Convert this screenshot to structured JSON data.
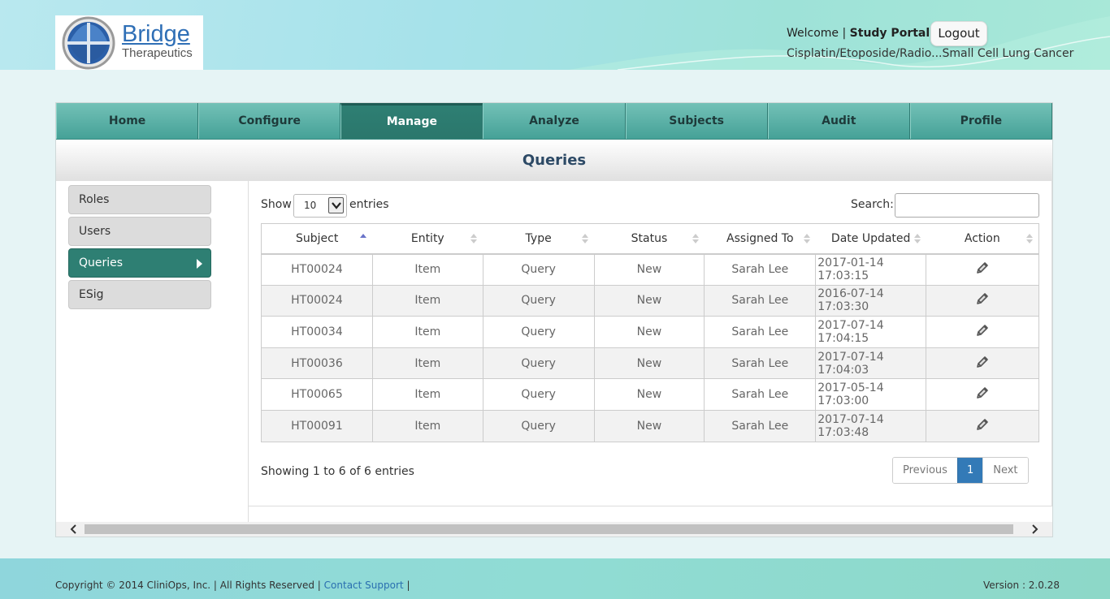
{
  "header": {
    "logo_name": "Bridge",
    "logo_sub": "Therapeutics",
    "welcome_prefix": "Welcome |",
    "user_name": "Study Portal",
    "logout_label": "Logout",
    "study_name": "Cisplatin/Etoposide/Radio...Small Cell Lung Cancer"
  },
  "nav": {
    "items": [
      "Home",
      "Configure",
      "Manage",
      "Analyze",
      "Subjects",
      "Audit",
      "Profile"
    ],
    "active": "Manage"
  },
  "page_title": "Queries",
  "sidebar": {
    "items": [
      "Roles",
      "Users",
      "Queries",
      "ESig"
    ],
    "active": "Queries"
  },
  "table_controls": {
    "show_label": "Show",
    "page_size": "10",
    "entries_label": "entries",
    "search_label": "Search:",
    "search_value": ""
  },
  "table": {
    "columns": [
      "Subject",
      "Entity",
      "Type",
      "Status",
      "Assigned To",
      "Date Updated",
      "Action"
    ],
    "sorted_column": "Subject",
    "rows": [
      {
        "subject": "HT00024",
        "entity": "Item",
        "type": "Query",
        "status": "New",
        "assigned_to": "Sarah Lee",
        "date_updated": "2017-01-14 17:03:15"
      },
      {
        "subject": "HT00024",
        "entity": "Item",
        "type": "Query",
        "status": "New",
        "assigned_to": "Sarah Lee",
        "date_updated": "2016-07-14 17:03:30"
      },
      {
        "subject": "HT00034",
        "entity": "Item",
        "type": "Query",
        "status": "New",
        "assigned_to": "Sarah Lee",
        "date_updated": "2017-07-14 17:04:15"
      },
      {
        "subject": "HT00036",
        "entity": "Item",
        "type": "Query",
        "status": "New",
        "assigned_to": "Sarah Lee",
        "date_updated": "2017-07-14 17:04:03"
      },
      {
        "subject": "HT00065",
        "entity": "Item",
        "type": "Query",
        "status": "New",
        "assigned_to": "Sarah Lee",
        "date_updated": "2017-05-14 17:03:00"
      },
      {
        "subject": "HT00091",
        "entity": "Item",
        "type": "Query",
        "status": "New",
        "assigned_to": "Sarah Lee",
        "date_updated": "2017-07-14 17:03:48"
      }
    ],
    "action_icon": "edit-pencil-icon"
  },
  "pagination": {
    "info": "Showing 1 to 6 of 6 entries",
    "previous_label": "Previous",
    "current_page": "1",
    "next_label": "Next"
  },
  "footer": {
    "copyright": "Copyright © 2014 CliniOps, Inc. | All Rights Reserved |",
    "support_link": "Contact Support",
    "separator": "|",
    "version": "Version : 2.0.28"
  },
  "colors": {
    "nav_teal": "#45a197",
    "active_teal": "#2e7f73",
    "title_navy": "#2d4a66",
    "link_blue": "#2a6fb0",
    "page_active": "#337ab7"
  }
}
